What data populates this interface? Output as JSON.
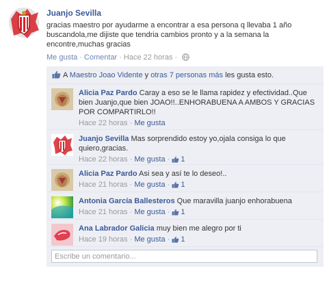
{
  "post": {
    "author": "Juanjo Sevilla",
    "text": "gracias maestro por ayudarme a encontrar a esa persona q llevaba 1 año buscandola,me dijiste que tendria cambios pronto y a la semana la encontre,muchas gracias",
    "actions": {
      "like": "Me gusta",
      "comment": "Comentar",
      "time": "Hace 22 horas"
    }
  },
  "likes": {
    "prefix": "A",
    "person": "Maestro Joao Vidente",
    "connector": "y",
    "others": "otras 7 personas más",
    "suffix": "les gusta esto."
  },
  "comments": [
    {
      "author": "Alicia Paz Pardo",
      "text": "Caray a eso se le llama rapidez y efectividad..Que bien Juanjo,que bien JOAO!!..ENHORABUENA A AMBOS Y GRACIAS POR COMPARTIRLO!!",
      "time": "Hace 22 horas",
      "like": "Me gusta",
      "count": "",
      "avatar": "alicia"
    },
    {
      "author": "Juanjo Sevilla",
      "text": "Mas sorprendido estoy yo,ojala consiga lo que quiero,gracias.",
      "time": "Hace 22 horas",
      "like": "Me gusta",
      "count": "1",
      "avatar": "juanjo"
    },
    {
      "author": "Alicia Paz Pardo",
      "text": "Asi sea y así te lo deseo!..",
      "time": "Hace 21 horas",
      "like": "Me gusta",
      "count": "1",
      "avatar": "alicia"
    },
    {
      "author": "Antonia García Ballesteros",
      "text": "Que maravilla juanjo enhorabuena",
      "time": "Hace 21 horas",
      "like": "Me gusta",
      "count": "1",
      "avatar": "antonia"
    },
    {
      "author": "Ana Labrador Galicia",
      "text": "muy bien me alegro por ti",
      "time": "Hace 19 horas",
      "like": "Me gusta",
      "count": "1",
      "avatar": "ana"
    }
  ],
  "composer": {
    "placeholder": "Escribe un comentario..."
  },
  "colors": {
    "link": "#3b5998",
    "ufi_bg": "#edeff4",
    "meta": "#999999"
  }
}
